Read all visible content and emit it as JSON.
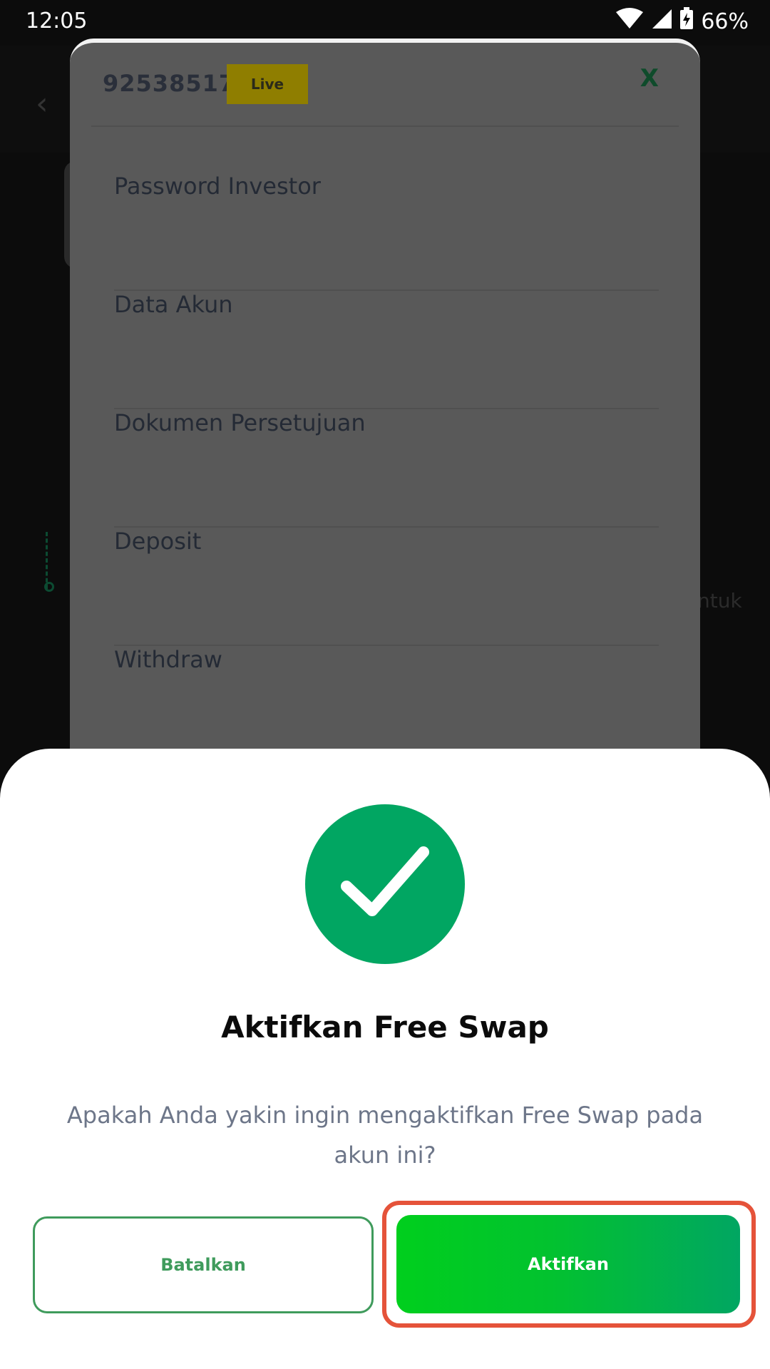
{
  "status_bar": {
    "time": "12:05",
    "battery_percent": "66%",
    "icons": [
      "wifi-icon",
      "signal-icon",
      "battery-charging-icon"
    ]
  },
  "account_sheet": {
    "account_number": "92538517",
    "badge": "Live",
    "close_label": "X",
    "menu_items": [
      {
        "label": "Password Investor"
      },
      {
        "label": "Data Akun"
      },
      {
        "label": "Dokumen Persetujuan"
      },
      {
        "label": "Deposit"
      },
      {
        "label": "Withdraw"
      }
    ]
  },
  "background": {
    "partial_text": "ntuk"
  },
  "confirm": {
    "icon": "check-circle-icon",
    "title": "Aktifkan Free Swap",
    "message": "Apakah Anda yakin ingin mengaktifkan Free Swap pada akun ini?",
    "cancel_label": "Batalkan",
    "activate_label": "Aktifkan"
  },
  "colors": {
    "brand_green": "#01a662",
    "bright_green": "#00cf1d",
    "highlight_red": "#e5533a",
    "live_badge": "#8f7e00"
  }
}
